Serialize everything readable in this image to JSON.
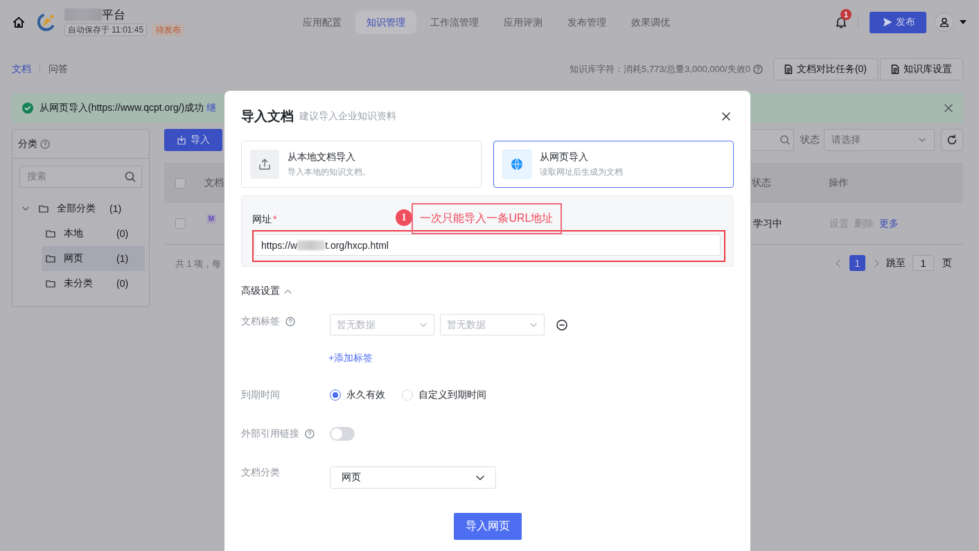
{
  "header": {
    "title": "平台",
    "autosave": "自动保存于 11:01:45",
    "status_badge": "待发布",
    "nav_tabs": [
      {
        "label": "应用配置",
        "selected": false
      },
      {
        "label": "知识管理",
        "selected": true
      },
      {
        "label": "工作流管理",
        "selected": false
      },
      {
        "label": "应用评测",
        "selected": false
      },
      {
        "label": "发布管理",
        "selected": false
      },
      {
        "label": "效果调优",
        "selected": false
      }
    ],
    "notification_count": "1",
    "publish_button": "发布"
  },
  "subheader": {
    "tabs": [
      {
        "label": "文档",
        "selected": true
      },
      {
        "label": "问答",
        "selected": false
      }
    ],
    "quota": "知识库字符：消耗5,773/总量3,000,000/失效0",
    "buttons": [
      "文档对比任务(0)",
      "知识库设置"
    ]
  },
  "alert": {
    "message": "从网页导入(https://www.qcpt.org/)成功",
    "link": "继"
  },
  "category_panel": {
    "title": "分类",
    "search_placeholder": "搜索",
    "tree": [
      {
        "label": "全部分类",
        "count": "(1)",
        "expanded": true,
        "selected": false,
        "children": [
          {
            "label": "本地",
            "count": "(0)",
            "selected": false
          },
          {
            "label": "网页",
            "count": "(1)",
            "selected": true
          },
          {
            "label": "未分类",
            "count": "(0)",
            "selected": false
          }
        ]
      }
    ]
  },
  "toolbar": {
    "import_button": "导入",
    "status_label": "状态",
    "status_placeholder": "请选择"
  },
  "table": {
    "columns": [
      "文档",
      "状态",
      "操作"
    ],
    "header_checked": false,
    "rows": [
      {
        "checked": false,
        "file_badge": "M",
        "status": "学习中",
        "actions": [
          {
            "label": "设置",
            "disabled": true
          },
          {
            "label": "删除",
            "disabled": true
          },
          {
            "label": "更多",
            "disabled": false
          }
        ]
      }
    ],
    "footer": "共 1 项，每",
    "pages": [
      {
        "label": "1",
        "selected": true
      }
    ],
    "jump_label": "跳至",
    "jump_value": "1",
    "page_unit": "页"
  },
  "dialog": {
    "title": "导入文档",
    "subtitle": "建议导入企业知识资料",
    "sources": [
      {
        "kind": "local",
        "title": "从本地文档导入",
        "description": "导入本地的知识文档。",
        "selected": false
      },
      {
        "kind": "web",
        "title": "从网页导入",
        "description": "读取网址后生成为文档",
        "selected": true
      }
    ],
    "url_field": {
      "label": "网址",
      "required_mark": "*",
      "value_before": "https://w",
      "value_after": "t.org/hxcp.html"
    },
    "annotation": {
      "number": "1",
      "text": "一次只能导入一条URL地址"
    },
    "advanced": {
      "title": "高级设置",
      "expanded": true
    },
    "tags": {
      "label": "文档标签",
      "selects": [
        {
          "placeholder": "暂无数据"
        },
        {
          "placeholder": "暂无数据"
        }
      ],
      "add_link": "+添加标签"
    },
    "expiry": {
      "label": "到期时间",
      "options": [
        {
          "label": "永久有效",
          "selected": true
        },
        {
          "label": "自定义到期时间",
          "selected": false
        }
      ]
    },
    "external_link": {
      "label": "外部引用链接",
      "on": false
    },
    "category": {
      "label": "文档分类",
      "value": "网页"
    },
    "submit": "导入网页"
  }
}
